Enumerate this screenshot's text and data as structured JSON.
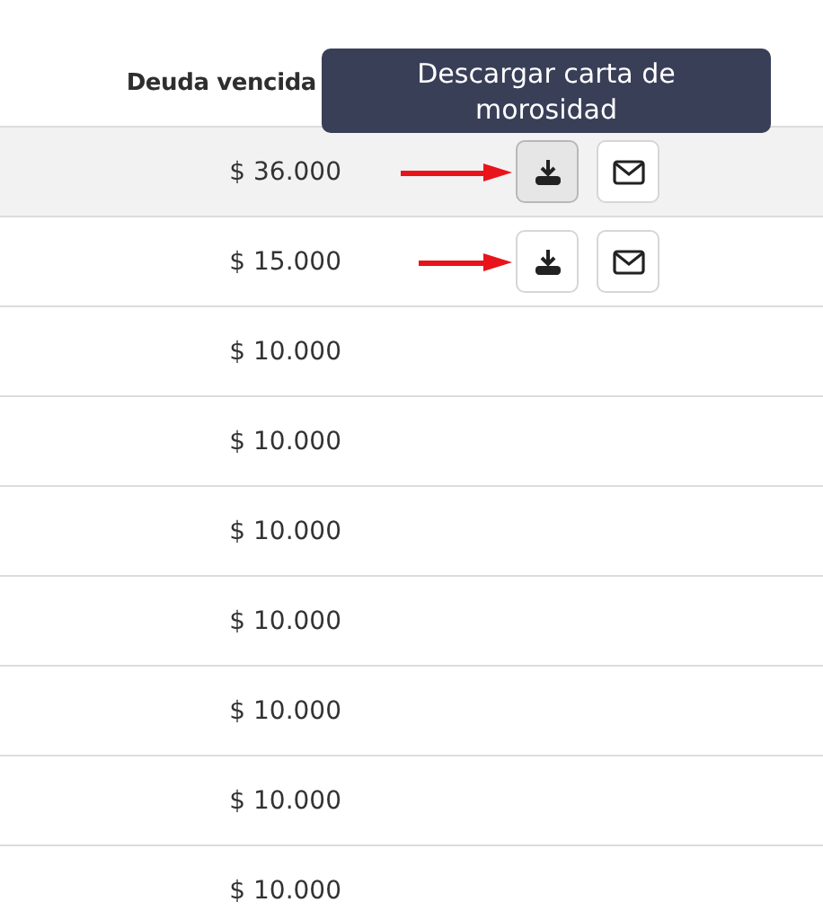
{
  "table": {
    "columns": [
      "Deuda vencida"
    ],
    "rows": [
      {
        "amount": "$ 36.000",
        "highlighted": true,
        "annotated": true,
        "actions": [
          {
            "kind": "download",
            "pressed": true
          },
          {
            "kind": "mail",
            "pressed": false
          }
        ]
      },
      {
        "amount": "$ 15.000",
        "highlighted": false,
        "annotated": true,
        "actions": [
          {
            "kind": "download",
            "pressed": false
          },
          {
            "kind": "mail",
            "pressed": false
          }
        ]
      },
      {
        "amount": "$ 10.000",
        "highlighted": false,
        "annotated": false
      },
      {
        "amount": "$ 10.000",
        "highlighted": false,
        "annotated": false
      },
      {
        "amount": "$ 10.000",
        "highlighted": false,
        "annotated": false
      },
      {
        "amount": "$ 10.000",
        "highlighted": false,
        "annotated": false
      },
      {
        "amount": "$ 10.000",
        "highlighted": false,
        "annotated": false
      },
      {
        "amount": "$ 10.000",
        "highlighted": false,
        "annotated": false
      },
      {
        "amount": "$ 10.000",
        "highlighted": false,
        "annotated": false
      }
    ]
  },
  "tooltip": {
    "text": "Descargar carta de morosidad"
  }
}
